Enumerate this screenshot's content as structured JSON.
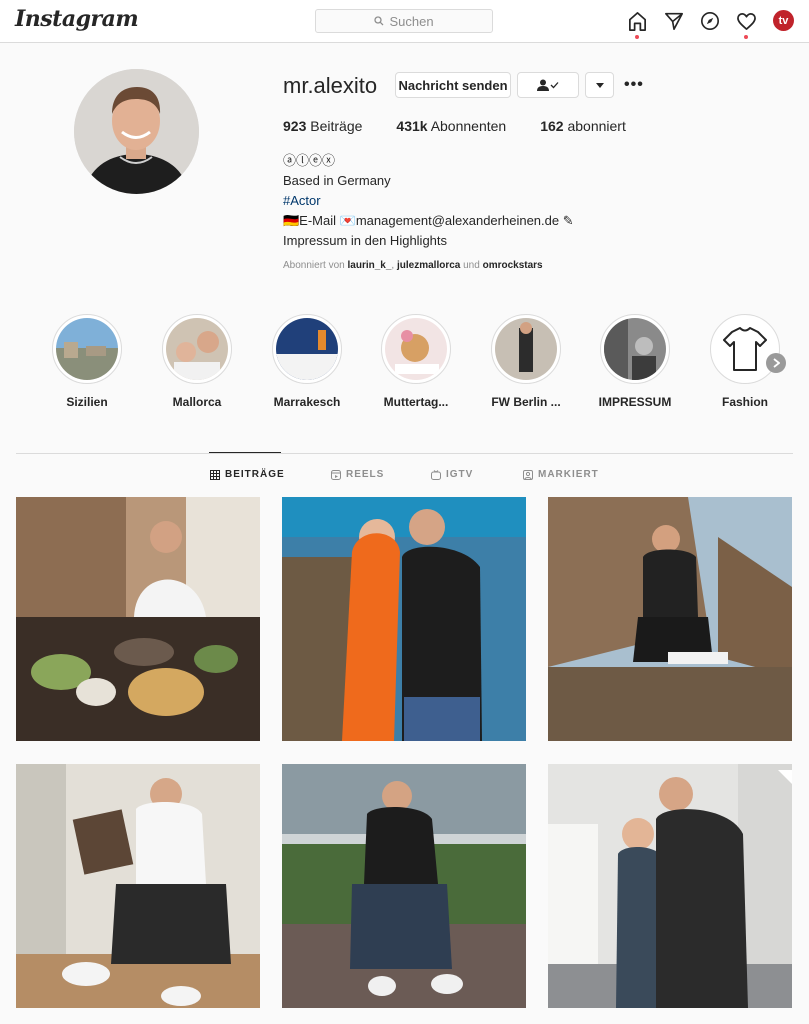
{
  "header": {
    "logo": "Instagram",
    "search_placeholder": "Suchen",
    "tv_badge": "tv",
    "icons": [
      "home-icon",
      "direct-icon",
      "explore-icon",
      "activity-icon",
      "igtv-profile-icon"
    ]
  },
  "profile": {
    "username": "mr.alexito",
    "message_button": "Nachricht senden",
    "follow_status_icon": "user-check-icon",
    "dropdown_icon": "chevron-down-icon",
    "more_label": "•••",
    "stats": {
      "posts_count": "923",
      "posts_label": "Beiträge",
      "followers_count": "431k",
      "followers_label": "Abonnenten",
      "following_count": "162",
      "following_label": "abonniert"
    },
    "bio": {
      "name": "ⓐⓛⓔⓧ",
      "line1": "Based in Germany",
      "hashtag": "#Actor",
      "line3": "🇩🇪E-Mail 💌management@alexanderheinen.de ✎",
      "line4": "Impressum in den Highlights"
    },
    "followed_by": {
      "prefix": "Abonniert von",
      "user1": "laurin_k_",
      "user2": "julezmallorca",
      "conj": "und",
      "user3": "omrockstars"
    }
  },
  "highlights": [
    {
      "label": "Sizilien"
    },
    {
      "label": "Mallorca"
    },
    {
      "label": "Marrakesch"
    },
    {
      "label": "Muttertag..."
    },
    {
      "label": "FW Berlin ..."
    },
    {
      "label": "IMPRESSUM"
    },
    {
      "label": "Fashion"
    }
  ],
  "tabs": [
    {
      "label": "BEITRÄGE",
      "active": true
    },
    {
      "label": "REELS",
      "active": false
    },
    {
      "label": "IGTV",
      "active": false
    },
    {
      "label": "MARKIERT",
      "active": false
    }
  ],
  "colors": {
    "accent_red": "#ed4956",
    "link_blue": "#00376b",
    "border": "#dbdbdb",
    "tv_red": "#c0232b"
  }
}
